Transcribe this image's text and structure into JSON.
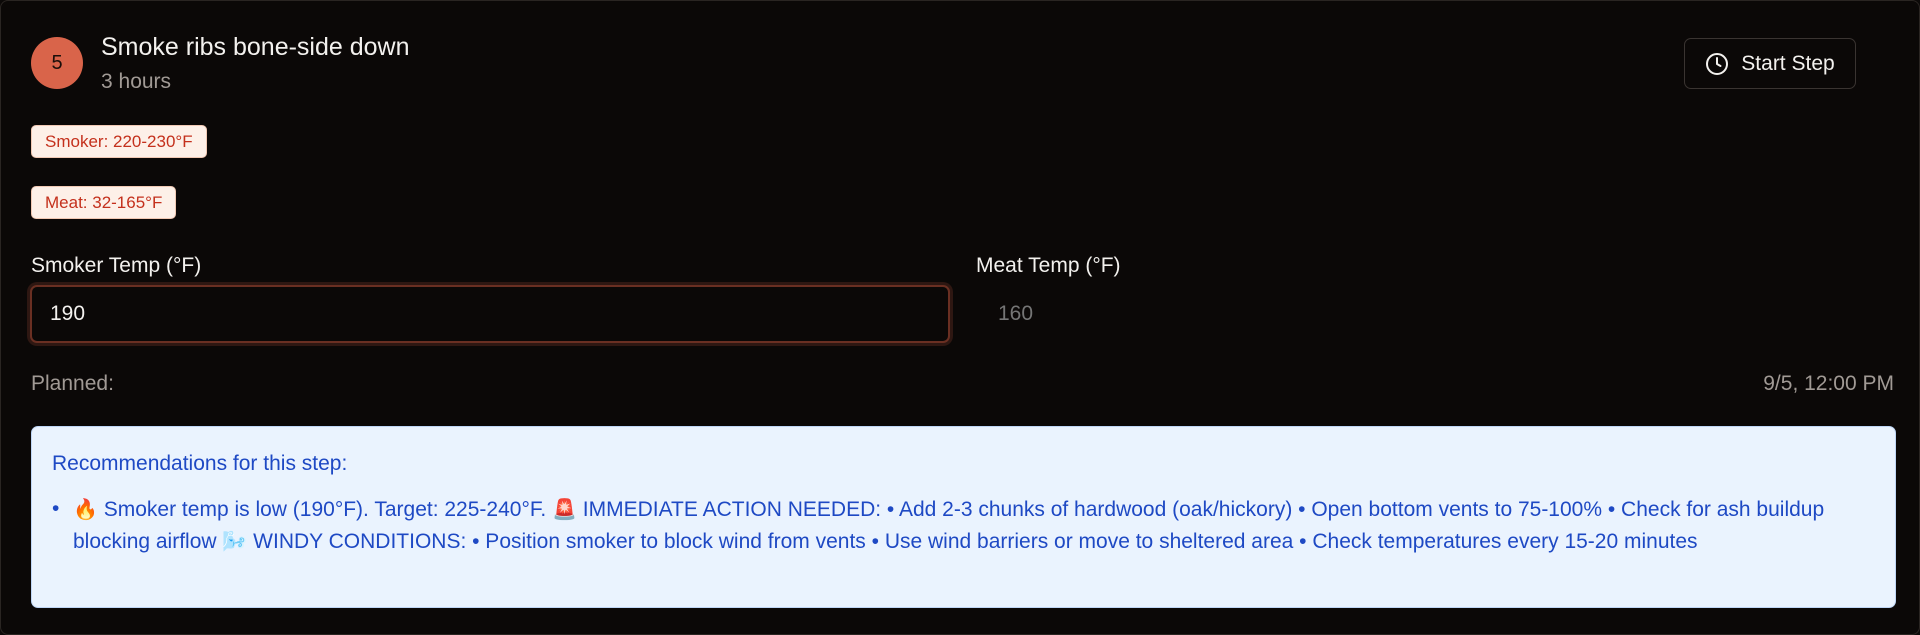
{
  "step": {
    "number": "5",
    "title": "Smoke ribs bone-side down",
    "duration": "3 hours",
    "start_button_label": "Start Step",
    "start_icon": "clock-icon"
  },
  "targets": {
    "smoker": "Smoker: 220-230°F",
    "meat": "Meat: 32-165°F"
  },
  "inputs": {
    "smoker_label": "Smoker Temp (°F)",
    "smoker_value": "190",
    "meat_label": "Meat Temp (°F)",
    "meat_placeholder": "160"
  },
  "planned": {
    "label": "Planned:",
    "value": "9/5, 12:00 PM"
  },
  "recommendations": {
    "title": "Recommendations for this step:",
    "bullet": "•",
    "items": [
      {
        "fire_emoji": "🔥",
        "low_temp": "Smoker temp is low (190°F). Target: 225-240°F.",
        "alarm_emoji": "🚨",
        "immediate": "IMMEDIATE ACTION NEEDED: • Add 2-3 chunks of hardwood (oak/hickory) • Open bottom vents to 75-100% • Check for ash buildup blocking airflow",
        "wind_emoji": "🌬️",
        "windy": "WINDY CONDITIONS: • Position smoker to block wind from vents • Use wind barriers or move to sheltered area • Check temperatures every 15-20 minutes"
      }
    ]
  },
  "colors": {
    "accent": "#d9644a",
    "recommendation_text": "#1e49c4",
    "recommendation_bg": "#eaf3fe",
    "tag_text": "#c4301c"
  }
}
